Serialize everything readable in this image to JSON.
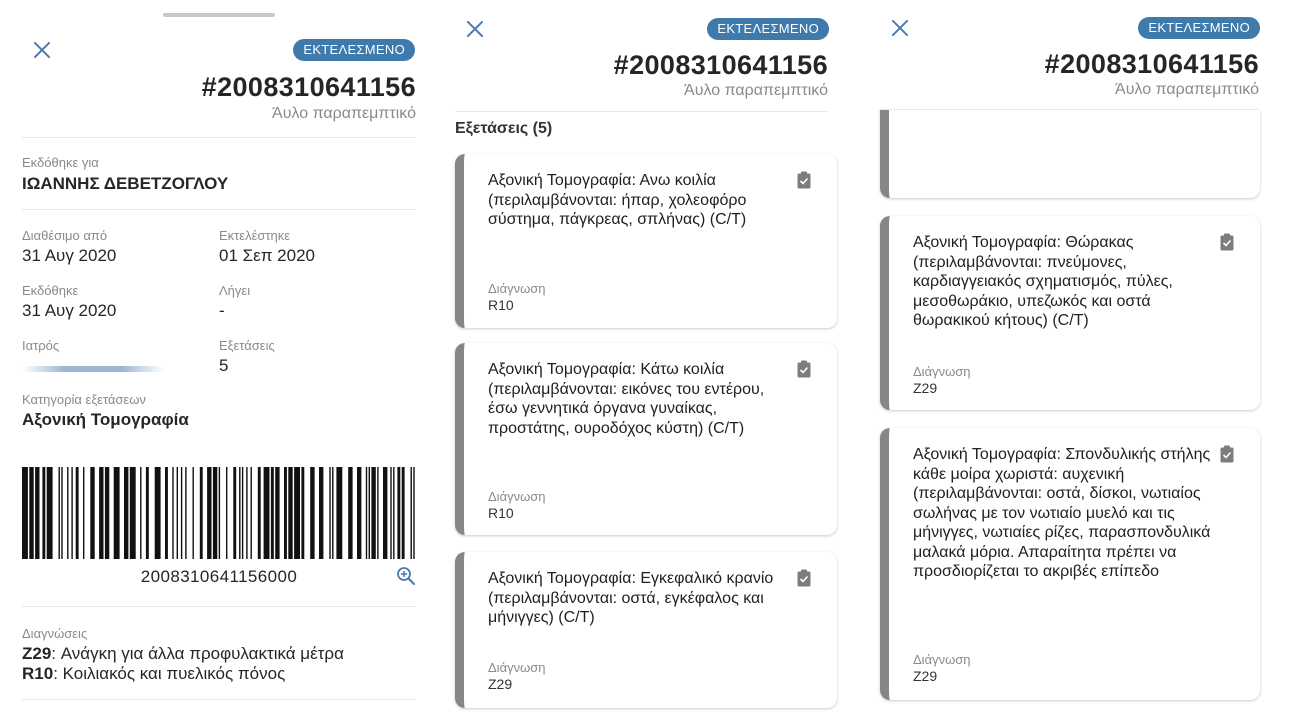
{
  "status_badge": "ΕΚΤΕΛΕΣΜΕΝΟ",
  "referral_number": "#2008310641156",
  "referral_type": "Άυλο παραπεμπτικό",
  "issued_for": {
    "label": "Εκδόθηκε για",
    "value": "ΙΩΑΝΝΗΣ ΔΕΒΕΤΖΟΓΛΟΥ"
  },
  "details": {
    "available_from": {
      "label": "Διαθέσιμο από",
      "value": "31 Αυγ 2020"
    },
    "executed": {
      "label": "Εκτελέστηκε",
      "value": "01 Σεπ 2020"
    },
    "issued": {
      "label": "Εκδόθηκε",
      "value": "31 Αυγ 2020"
    },
    "expires": {
      "label": "Λήγει",
      "value": "-"
    },
    "doctor": {
      "label": "Ιατρός",
      "value": ""
    },
    "exams_count": {
      "label": "Εξετάσεις",
      "value": "5"
    }
  },
  "exam_category": {
    "label": "Κατηγορία εξετάσεων",
    "value": "Αξονική Τομογραφία"
  },
  "barcode": {
    "number": "2008310641156000"
  },
  "diagnoses": {
    "label": "Διαγνώσεις",
    "items": [
      {
        "code": "Z29",
        "text": ": Ανάγκη για άλλα προφυλακτικά μέτρα"
      },
      {
        "code": "R10",
        "text": ": Κοιλιακός και πυελικός πόνος"
      }
    ]
  },
  "exams_section_title": "Εξετάσεις (5)",
  "diagnosis_label": "Διάγνωση",
  "exams": [
    {
      "title": "Αξονική Τομογραφία: Ανω κοιλία (περιλαμβάνονται: ήπαρ, χολεοφόρο σύστημα, πάγκρεας, σπλήνας) (C/T)",
      "diagnosis": "R10"
    },
    {
      "title": "Αξονική Τομογραφία: Κάτω κοιλία (περιλαμβάνονται: εικόνες του εντέρου, έσω γεννητικά όργανα γυναίκας, προστάτης, ουροδόχος κύστη) (C/T)",
      "diagnosis": "R10"
    },
    {
      "title": "Αξονική Τομογραφία: Εγκεφαλικό κρανίο (περιλαμβάνονται: οστά, εγκέφαλος και μήνιγγες) (C/T)",
      "diagnosis": "Z29"
    },
    {
      "title": "Αξονική Τομογραφία: Θώρακας (περιλαμβάνονται: πνεύμονες, καρδιαγγειακός σχηματισμός, πύλες, μεσοθωράκιο, υπεζωκός και οστά θωρακικού κήτους) (C/T)",
      "diagnosis": "Z29"
    },
    {
      "title": "Αξονική Τομογραφία: Σπονδυλικής στήλης κάθε μοίρα χωριστά: αυχενική (περιλαμβάνονται: οστά, δίσκοι, νωτιαίος σωλήνας με τον νωτιαίο μυελό και τις μήνιγγες, νωτιαίες ρίζες, παρασπονδυλικά μαλακά μόρια. Απαραίτητα πρέπει να προσδιορίζεται το ακριβές επίπεδο",
      "diagnosis": "Z29"
    }
  ],
  "icons": {
    "close": "close-icon",
    "zoom": "zoom-in-icon",
    "exam": "clipboard-check-icon"
  },
  "colors": {
    "accent": "#3f7aad",
    "card_stripe": "#868686"
  }
}
